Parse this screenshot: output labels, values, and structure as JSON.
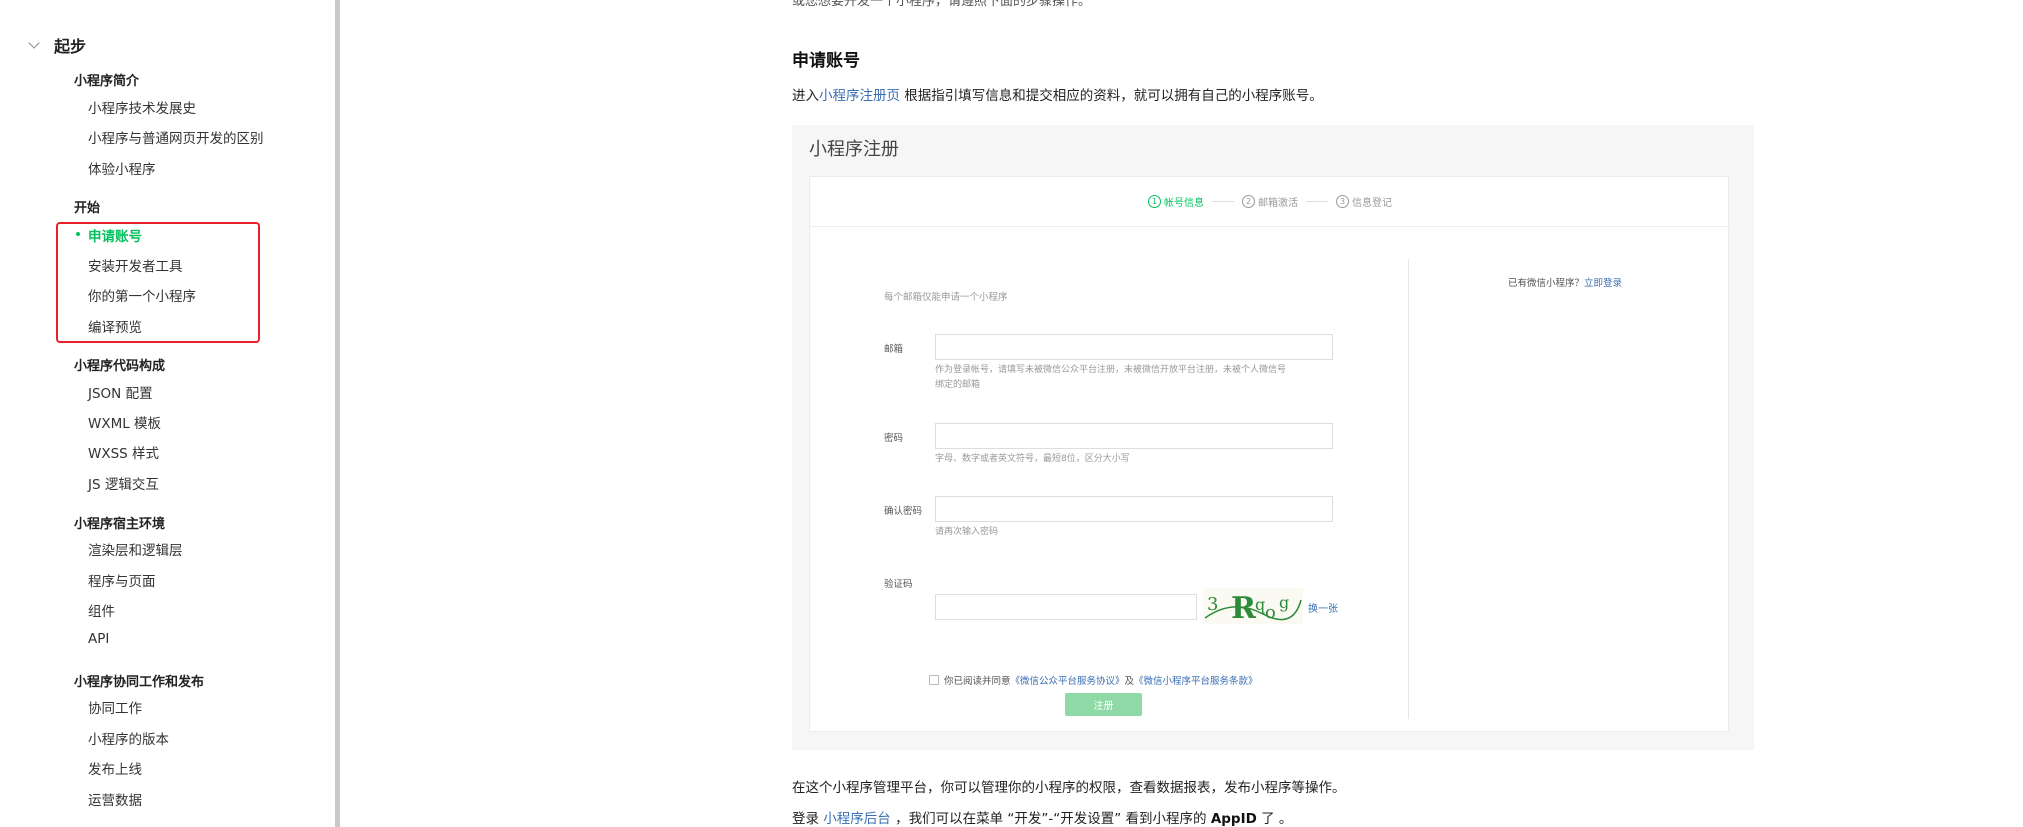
{
  "sidebar": {
    "section_title": "起步",
    "groups": [
      {
        "title": "小程序简介",
        "items": [
          "小程序技术发展史",
          "小程序与普通网页开发的区别",
          "体验小程序"
        ]
      },
      {
        "title": "开始",
        "items": [
          "申请账号",
          "安装开发者工具",
          "你的第一个小程序",
          "编译预览"
        ]
      },
      {
        "title": "小程序代码构成",
        "items": [
          "JSON 配置",
          "WXML 模板",
          "WXSS 样式",
          "JS 逻辑交互"
        ]
      },
      {
        "title": "小程序宿主环境",
        "items": [
          "渲染层和逻辑层",
          "程序与页面",
          "组件",
          "API"
        ]
      },
      {
        "title": "小程序协同工作和发布",
        "items": [
          "协同工作",
          "小程序的版本",
          "发布上线",
          "运营数据"
        ]
      }
    ]
  },
  "article": {
    "cut_text": "或您想要开发一个小程序，请遵照下面的步骤操作。",
    "heading": "申请账号",
    "intro_prefix": "进入",
    "intro_link": "小程序注册页",
    "intro_suffix": " 根据指引填写信息和提交相应的资料，就可以拥有自己的小程序账号。",
    "para2": "在这个小程序管理平台，你可以管理你的小程序的权限，查看数据报表，发布小程序等操作。",
    "para3_prefix": "登录 ",
    "para3_link": "小程序后台",
    "para3_mid": " ，我们可以在菜单 “开发”-“开发设置” 看到小程序的 ",
    "para3_strong": "AppID",
    "para3_suffix": " 了 。"
  },
  "screenshot": {
    "title": "小程序注册",
    "steps": [
      {
        "num": "1",
        "label": "帐号信息"
      },
      {
        "num": "2",
        "label": "邮箱激活"
      },
      {
        "num": "3",
        "label": "信息登记"
      }
    ],
    "note": "每个邮箱仅能申请一个小程序",
    "email_label": "邮箱",
    "email_hint_1": "作为登录帐号，请填写未被微信公众平台注册，未被微信开放平台注册，未被个人微信号",
    "email_hint_2": "绑定的邮箱",
    "password_label": "密码",
    "password_hint": "字母、数字或者英文符号，最短8位，区分大小写",
    "confirm_label": "确认密码",
    "confirm_hint": "请再次输入密码",
    "captcha_label": "验证码",
    "captcha_refresh": "换一张",
    "agree_prefix": "你已阅读并同意",
    "agree_link1": "《微信公众平台服务协议》",
    "agree_mid": "及",
    "agree_link2": "《微信小程序平台服务条款》",
    "register_button": "注册",
    "login_prefix": "已有微信小程序？",
    "login_link": "立即登录"
  },
  "colors": {
    "accent": "#07c160",
    "link": "#3a6fb4",
    "highlight": "#e8202a"
  }
}
